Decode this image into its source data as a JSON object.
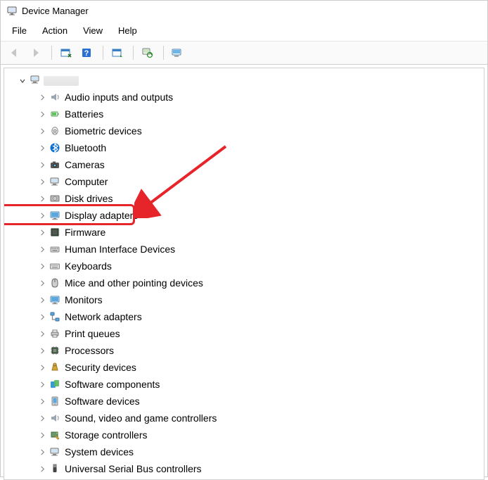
{
  "title": "Device Manager",
  "menu": {
    "file": "File",
    "action": "Action",
    "view": "View",
    "help": "Help"
  },
  "toolbar": {
    "back": "Back",
    "forward": "Forward",
    "show_hidden": "Show hidden devices",
    "help": "Help",
    "action_menu": "Action menu",
    "scan": "Scan for hardware changes",
    "add_legacy": "Add legacy hardware"
  },
  "root": {
    "expanded": true,
    "label": ""
  },
  "categories": [
    {
      "id": "audio",
      "label": "Audio inputs and outputs"
    },
    {
      "id": "batteries",
      "label": "Batteries"
    },
    {
      "id": "biometric",
      "label": "Biometric devices"
    },
    {
      "id": "bluetooth",
      "label": "Bluetooth"
    },
    {
      "id": "cameras",
      "label": "Cameras"
    },
    {
      "id": "computer",
      "label": "Computer"
    },
    {
      "id": "disk",
      "label": "Disk drives"
    },
    {
      "id": "display",
      "label": "Display adapters",
      "highlighted": true
    },
    {
      "id": "firmware",
      "label": "Firmware"
    },
    {
      "id": "hid",
      "label": "Human Interface Devices"
    },
    {
      "id": "keyboards",
      "label": "Keyboards"
    },
    {
      "id": "mice",
      "label": "Mice and other pointing devices"
    },
    {
      "id": "monitors",
      "label": "Monitors"
    },
    {
      "id": "network",
      "label": "Network adapters"
    },
    {
      "id": "printq",
      "label": "Print queues"
    },
    {
      "id": "processors",
      "label": "Processors"
    },
    {
      "id": "security",
      "label": "Security devices"
    },
    {
      "id": "swcomp",
      "label": "Software components"
    },
    {
      "id": "swdev",
      "label": "Software devices"
    },
    {
      "id": "sound",
      "label": "Sound, video and game controllers"
    },
    {
      "id": "storage",
      "label": "Storage controllers"
    },
    {
      "id": "system",
      "label": "System devices"
    },
    {
      "id": "usb",
      "label": "Universal Serial Bus controllers"
    }
  ],
  "annotations": {
    "highlight_target": "display",
    "arrow": true
  }
}
